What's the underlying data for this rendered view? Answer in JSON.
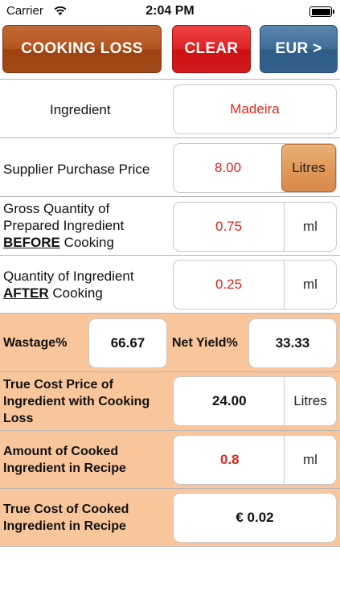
{
  "status_bar": {
    "carrier": "Carrier",
    "time": "2:04 PM"
  },
  "toolbar": {
    "cooking_loss": "COOKING LOSS",
    "clear": "CLEAR",
    "currency": "EUR >"
  },
  "ingredient": {
    "label": "Ingredient",
    "value": "Madeira"
  },
  "supplier_price": {
    "label": "Supplier Purchase Price",
    "value": "8.00",
    "unit": "Litres"
  },
  "gross_quantity": {
    "label_line1": "Gross Quantity of",
    "label_line2": "Prepared Ingredient",
    "label_emph": "BEFORE",
    "label_rest": " Cooking",
    "value": "0.75",
    "unit": "ml"
  },
  "after_quantity": {
    "label_line1": "Quantity of Ingredient",
    "label_emph": "AFTER",
    "label_rest": " Cooking",
    "value": "0.25",
    "unit": "ml"
  },
  "wastage": {
    "label": "Wastage%",
    "value": "66.67",
    "net_label": "Net Yield%",
    "net_value": "33.33"
  },
  "true_cost": {
    "label_line1": "True Cost Price of",
    "label_line2": "Ingredient with Cooking",
    "label_line3": "Loss",
    "value": "24.00",
    "unit": "Litres"
  },
  "cooked_amount": {
    "label_line1": "Amount of Cooked",
    "label_line2": "Ingredient in Recipe",
    "value": "0.8",
    "unit": "ml"
  },
  "cooked_cost": {
    "label_line1": "True Cost of Cooked",
    "label_line2": "Ingredient in Recipe",
    "value": "€ 0.02"
  },
  "colors": {
    "accent_red": "#e0261e",
    "peach": "#f9c59b",
    "brown": "#a14a18",
    "blue": "#34628d"
  }
}
